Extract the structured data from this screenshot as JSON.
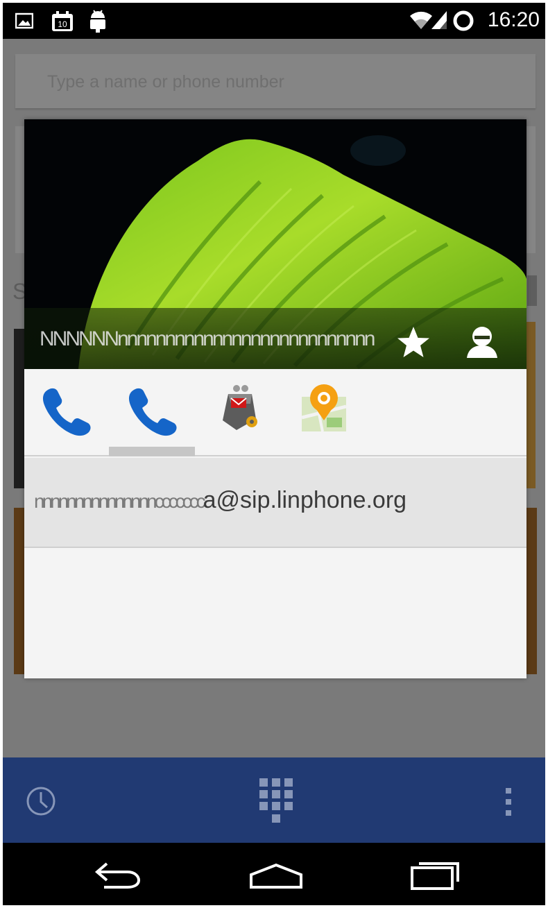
{
  "status_bar": {
    "time": "16:20",
    "icons": [
      "image-notification-icon",
      "calendar-icon",
      "android-debug-icon",
      "wifi-icon",
      "signal-icon",
      "sync-icon"
    ],
    "calendar_day": "10"
  },
  "dialer_background": {
    "search_placeholder": "Type a name or phone number",
    "section_letter": "S"
  },
  "quick_contact": {
    "name": "NNNNNNnnnnnnnnnnnnnnnnnnnnnnnnnnn",
    "actions": [
      "phone-call-icon",
      "sip-call-icon",
      "email-app-icon",
      "maps-icon"
    ],
    "selected_action_index": 1,
    "entry_blurred_prefix": "nnnnnnnnnnnnnnnccccccc",
    "entry_visible": "a@sip.linphone.org"
  },
  "app_bar": {
    "icons": [
      "history-icon",
      "dialpad-icon",
      "overflow-menu-icon"
    ]
  },
  "nav_bar": {
    "icons": [
      "back-icon",
      "home-icon",
      "recent-apps-icon"
    ]
  },
  "colors": {
    "app_bar": "#213a73",
    "phone_icon": "#1565c8",
    "maps_icon": "#f5a012"
  }
}
